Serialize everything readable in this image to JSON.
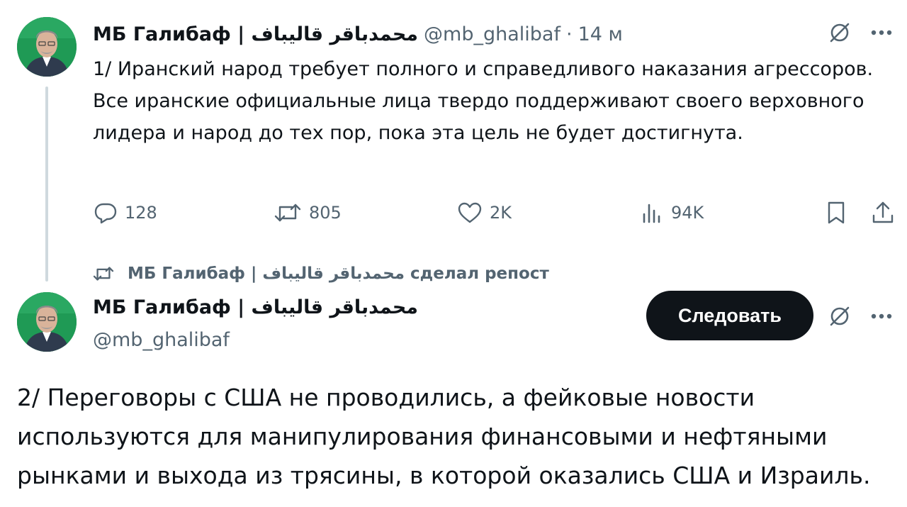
{
  "tweet1": {
    "author_name": "МБ Галибаф | محمدباقر قالیباف",
    "handle": "@mb_ghalibaf",
    "separator": "·",
    "time": "14 м",
    "text": "1/ Иранский народ требует полного и справедливого наказания агрессоров. Все иранские официальные лица твердо поддерживают своего верховного лидера и народ до тех пор, пока эта цель не будет достигнута.",
    "replies": "128",
    "reposts": "805",
    "likes": "2K",
    "views": "94K"
  },
  "repost_banner": {
    "text": "МБ Галибаф | محمدباقر قالیباف сделал репост"
  },
  "tweet2": {
    "author_name": "МБ Галибаф | محمدباقر قالیباف",
    "handle": "@mb_ghalibaf",
    "follow_label": "Следовать",
    "text": "2/ Переговоры с США не проводились, а фейковые новости используются для манипулирования финансовыми и нефтяными рынками и выхода из трясины, в которой оказались США и Израиль."
  },
  "icons": {
    "grok": "grok-icon",
    "more": "more-icon",
    "reply": "reply-icon",
    "repost": "repost-icon",
    "like": "heart-icon",
    "views": "views-icon",
    "bookmark": "bookmark-icon",
    "share": "share-icon"
  },
  "colors": {
    "text": "#0f1419",
    "muted": "#536471",
    "thread_line": "#cfd9de",
    "follow_button": "#0f1419"
  }
}
